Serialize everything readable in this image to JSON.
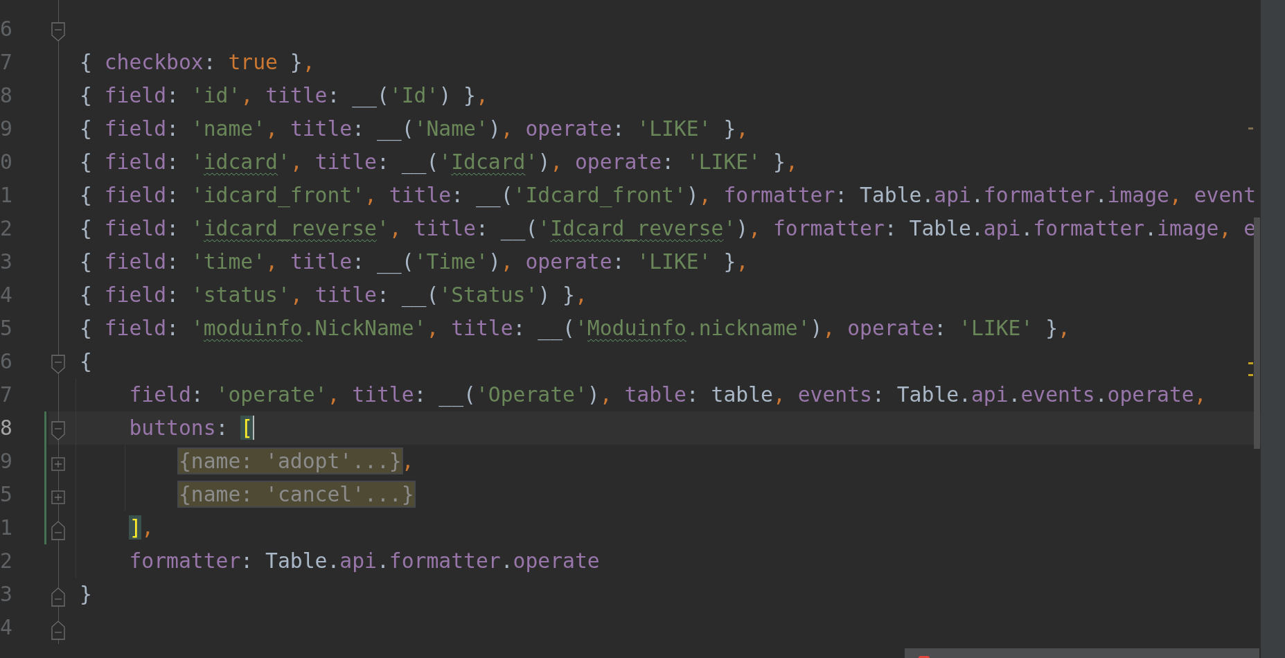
{
  "editor": {
    "lines": [
      {
        "number": "6",
        "fold": {
          "kind": "start"
        },
        "current": false,
        "changed": false
      },
      {
        "number": "7",
        "current": false,
        "changed": false,
        "tokens": [
          {
            "t": "{ ",
            "kind": "plain"
          },
          {
            "t": "checkbox",
            "kind": "key"
          },
          {
            "t": ": ",
            "kind": "plain"
          },
          {
            "t": "true",
            "kind": "keyword"
          },
          {
            "t": " }",
            "kind": "plain"
          },
          {
            "t": ",",
            "kind": "keyword"
          }
        ]
      },
      {
        "number": "8",
        "current": false,
        "changed": false,
        "tokens": [
          {
            "t": "{ ",
            "kind": "plain"
          },
          {
            "t": "field",
            "kind": "key"
          },
          {
            "t": ": ",
            "kind": "plain"
          },
          {
            "t": "'id'",
            "kind": "string"
          },
          {
            "t": ", ",
            "kind": "keyword"
          },
          {
            "t": "title",
            "kind": "key"
          },
          {
            "t": ": __(",
            "kind": "plain"
          },
          {
            "t": "'Id'",
            "kind": "string"
          },
          {
            "t": ") }",
            "kind": "plain"
          },
          {
            "t": ",",
            "kind": "keyword"
          }
        ]
      },
      {
        "number": "9",
        "current": false,
        "changed": false,
        "tokens": [
          {
            "t": "{ ",
            "kind": "plain"
          },
          {
            "t": "field",
            "kind": "key"
          },
          {
            "t": ": ",
            "kind": "plain"
          },
          {
            "t": "'name'",
            "kind": "string"
          },
          {
            "t": ", ",
            "kind": "keyword"
          },
          {
            "t": "title",
            "kind": "key"
          },
          {
            "t": ": __(",
            "kind": "plain"
          },
          {
            "t": "'Name'",
            "kind": "string"
          },
          {
            "t": ")",
            "kind": "plain"
          },
          {
            "t": ", ",
            "kind": "keyword"
          },
          {
            "t": "operate",
            "kind": "key"
          },
          {
            "t": ": ",
            "kind": "plain"
          },
          {
            "t": "'LIKE'",
            "kind": "string"
          },
          {
            "t": " }",
            "kind": "plain"
          },
          {
            "t": ",",
            "kind": "keyword"
          }
        ]
      },
      {
        "number": "0",
        "current": false,
        "changed": false,
        "tokens": [
          {
            "t": "{ ",
            "kind": "plain"
          },
          {
            "t": "field",
            "kind": "key"
          },
          {
            "t": ": ",
            "kind": "plain"
          },
          {
            "t": "'",
            "kind": "string"
          },
          {
            "t": "idcard",
            "kind": "string",
            "typo": true
          },
          {
            "t": "'",
            "kind": "string"
          },
          {
            "t": ", ",
            "kind": "keyword"
          },
          {
            "t": "title",
            "kind": "key"
          },
          {
            "t": ": __(",
            "kind": "plain"
          },
          {
            "t": "'",
            "kind": "string"
          },
          {
            "t": "Idcard",
            "kind": "string",
            "typo": true
          },
          {
            "t": "'",
            "kind": "string"
          },
          {
            "t": ")",
            "kind": "plain"
          },
          {
            "t": ", ",
            "kind": "keyword"
          },
          {
            "t": "operate",
            "kind": "key"
          },
          {
            "t": ": ",
            "kind": "plain"
          },
          {
            "t": "'LIKE'",
            "kind": "string"
          },
          {
            "t": " }",
            "kind": "plain"
          },
          {
            "t": ",",
            "kind": "keyword"
          }
        ]
      },
      {
        "number": "1",
        "current": false,
        "changed": false,
        "tokens": [
          {
            "t": "{ ",
            "kind": "plain"
          },
          {
            "t": "field",
            "kind": "key"
          },
          {
            "t": ": ",
            "kind": "plain"
          },
          {
            "t": "'idcard_front'",
            "kind": "string"
          },
          {
            "t": ", ",
            "kind": "keyword"
          },
          {
            "t": "title",
            "kind": "key"
          },
          {
            "t": ": __(",
            "kind": "plain"
          },
          {
            "t": "'Idcard_front'",
            "kind": "string"
          },
          {
            "t": ")",
            "kind": "plain"
          },
          {
            "t": ", ",
            "kind": "keyword"
          },
          {
            "t": "formatter",
            "kind": "key"
          },
          {
            "t": ": Table.",
            "kind": "plain"
          },
          {
            "t": "api",
            "kind": "key"
          },
          {
            "t": ".",
            "kind": "plain"
          },
          {
            "t": "formatter",
            "kind": "key"
          },
          {
            "t": ".",
            "kind": "plain"
          },
          {
            "t": "image",
            "kind": "key"
          },
          {
            "t": ", ",
            "kind": "keyword"
          },
          {
            "t": "event",
            "kind": "key"
          }
        ]
      },
      {
        "number": "2",
        "current": false,
        "changed": false,
        "tokens": [
          {
            "t": "{ ",
            "kind": "plain"
          },
          {
            "t": "field",
            "kind": "key"
          },
          {
            "t": ": ",
            "kind": "plain"
          },
          {
            "t": "'",
            "kind": "string"
          },
          {
            "t": "idcard_reverse",
            "kind": "string",
            "typo": true
          },
          {
            "t": "'",
            "kind": "string"
          },
          {
            "t": ", ",
            "kind": "keyword"
          },
          {
            "t": "title",
            "kind": "key"
          },
          {
            "t": ": __(",
            "kind": "plain"
          },
          {
            "t": "'",
            "kind": "string"
          },
          {
            "t": "Idcard_reverse",
            "kind": "string",
            "typo": true
          },
          {
            "t": "'",
            "kind": "string"
          },
          {
            "t": ")",
            "kind": "plain"
          },
          {
            "t": ", ",
            "kind": "keyword"
          },
          {
            "t": "formatter",
            "kind": "key"
          },
          {
            "t": ": Table.",
            "kind": "plain"
          },
          {
            "t": "api",
            "kind": "key"
          },
          {
            "t": ".",
            "kind": "plain"
          },
          {
            "t": "formatter",
            "kind": "key"
          },
          {
            "t": ".",
            "kind": "plain"
          },
          {
            "t": "image",
            "kind": "key"
          },
          {
            "t": ", ",
            "kind": "keyword"
          },
          {
            "t": "e",
            "kind": "key"
          }
        ]
      },
      {
        "number": "3",
        "current": false,
        "changed": false,
        "tokens": [
          {
            "t": "{ ",
            "kind": "plain"
          },
          {
            "t": "field",
            "kind": "key"
          },
          {
            "t": ": ",
            "kind": "plain"
          },
          {
            "t": "'time'",
            "kind": "string"
          },
          {
            "t": ", ",
            "kind": "keyword"
          },
          {
            "t": "title",
            "kind": "key"
          },
          {
            "t": ": __(",
            "kind": "plain"
          },
          {
            "t": "'Time'",
            "kind": "string"
          },
          {
            "t": ")",
            "kind": "plain"
          },
          {
            "t": ", ",
            "kind": "keyword"
          },
          {
            "t": "operate",
            "kind": "key"
          },
          {
            "t": ": ",
            "kind": "plain"
          },
          {
            "t": "'LIKE'",
            "kind": "string"
          },
          {
            "t": " }",
            "kind": "plain"
          },
          {
            "t": ",",
            "kind": "keyword"
          }
        ]
      },
      {
        "number": "4",
        "current": false,
        "changed": false,
        "tokens": [
          {
            "t": "{ ",
            "kind": "plain"
          },
          {
            "t": "field",
            "kind": "key"
          },
          {
            "t": ": ",
            "kind": "plain"
          },
          {
            "t": "'status'",
            "kind": "string"
          },
          {
            "t": ", ",
            "kind": "keyword"
          },
          {
            "t": "title",
            "kind": "key"
          },
          {
            "t": ": __(",
            "kind": "plain"
          },
          {
            "t": "'Status'",
            "kind": "string"
          },
          {
            "t": ") }",
            "kind": "plain"
          },
          {
            "t": ",",
            "kind": "keyword"
          }
        ]
      },
      {
        "number": "5",
        "current": false,
        "changed": false,
        "tokens": [
          {
            "t": "{ ",
            "kind": "plain"
          },
          {
            "t": "field",
            "kind": "key"
          },
          {
            "t": ": ",
            "kind": "plain"
          },
          {
            "t": "'",
            "kind": "string"
          },
          {
            "t": "moduinfo",
            "kind": "string",
            "typo": true
          },
          {
            "t": ".NickName'",
            "kind": "string"
          },
          {
            "t": ", ",
            "kind": "keyword"
          },
          {
            "t": "title",
            "kind": "key"
          },
          {
            "t": ": __(",
            "kind": "plain"
          },
          {
            "t": "'",
            "kind": "string"
          },
          {
            "t": "Moduinfo",
            "kind": "string",
            "typo": true
          },
          {
            "t": ".nickname'",
            "kind": "string"
          },
          {
            "t": ")",
            "kind": "plain"
          },
          {
            "t": ", ",
            "kind": "keyword"
          },
          {
            "t": "operate",
            "kind": "key"
          },
          {
            "t": ": ",
            "kind": "plain"
          },
          {
            "t": "'LIKE'",
            "kind": "string"
          },
          {
            "t": " }",
            "kind": "plain"
          },
          {
            "t": ",",
            "kind": "keyword"
          }
        ]
      },
      {
        "number": "6",
        "fold": {
          "kind": "start"
        },
        "current": false,
        "changed": false,
        "tokens": [
          {
            "t": "{",
            "kind": "plain"
          }
        ],
        "children": [
          {
            "number": "7",
            "current": false,
            "changed": false,
            "tokens": [
              {
                "t": "field",
                "kind": "key"
              },
              {
                "t": ": ",
                "kind": "plain"
              },
              {
                "t": "'operate'",
                "kind": "string"
              },
              {
                "t": ", ",
                "kind": "keyword"
              },
              {
                "t": "title",
                "kind": "key"
              },
              {
                "t": ": __(",
                "kind": "plain"
              },
              {
                "t": "'Operate'",
                "kind": "string"
              },
              {
                "t": ")",
                "kind": "plain"
              },
              {
                "t": ", ",
                "kind": "keyword"
              },
              {
                "t": "table",
                "kind": "key"
              },
              {
                "t": ": table",
                "kind": "plain"
              },
              {
                "t": ", ",
                "kind": "keyword"
              },
              {
                "t": "events",
                "kind": "key"
              },
              {
                "t": ": Table.",
                "kind": "plain"
              },
              {
                "t": "api",
                "kind": "key"
              },
              {
                "t": ".",
                "kind": "plain"
              },
              {
                "t": "events",
                "kind": "key"
              },
              {
                "t": ".",
                "kind": "plain"
              },
              {
                "t": "operate",
                "kind": "key"
              },
              {
                "t": ",",
                "kind": "keyword"
              }
            ]
          },
          {
            "number": "8",
            "fold": {
              "kind": "start"
            },
            "current": true,
            "changed": true,
            "tokens": [
              {
                "t": "buttons",
                "kind": "key"
              },
              {
                "t": ": ",
                "kind": "plain"
              },
              {
                "t": "[",
                "kind": "bracket",
                "caret": true
              }
            ],
            "children": [
              {
                "number": "9",
                "fold": {
                  "kind": "folded"
                },
                "current": false,
                "changed": true,
                "tokens": [
                  {
                    "t": "{name: 'adopt'...}",
                    "kind": "fold"
                  },
                  {
                    "t": ",",
                    "kind": "keyword"
                  }
                ]
              },
              {
                "number": "5",
                "fold": {
                  "kind": "folded"
                },
                "current": false,
                "changed": true,
                "tokens": [
                  {
                    "t": "{name: 'cancel'...}",
                    "kind": "fold"
                  }
                ]
              }
            ]
          },
          {
            "number": "1",
            "fold": {
              "kind": "end"
            },
            "current": false,
            "changed": true,
            "tokens": [
              {
                "t": "]",
                "kind": "bracket"
              },
              {
                "t": ",",
                "kind": "keyword"
              }
            ]
          },
          {
            "number": "2",
            "current": false,
            "changed": false,
            "tokens": [
              {
                "t": "formatter",
                "kind": "key"
              },
              {
                "t": ": Table.",
                "kind": "plain"
              },
              {
                "t": "api",
                "kind": "key"
              },
              {
                "t": ".",
                "kind": "plain"
              },
              {
                "t": "formatter",
                "kind": "key"
              },
              {
                "t": ".",
                "kind": "plain"
              },
              {
                "t": "operate",
                "kind": "key"
              }
            ]
          }
        ]
      },
      {
        "number": "3",
        "fold": {
          "kind": "end"
        },
        "current": false,
        "changed": false,
        "tokens": [
          {
            "t": "}",
            "kind": "plain"
          }
        ]
      },
      {
        "number": "4",
        "fold": {
          "kind": "end"
        },
        "current": false,
        "changed": false
      }
    ]
  }
}
